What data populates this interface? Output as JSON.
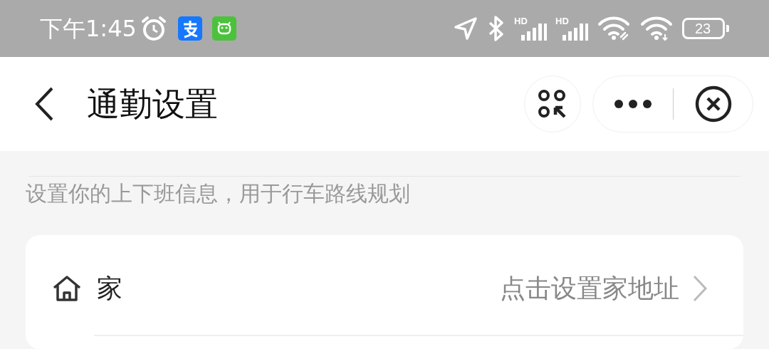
{
  "status_bar": {
    "time": "下午1:45",
    "signal_labels": [
      "HD",
      "HD"
    ],
    "battery": "23"
  },
  "header": {
    "title": "通勤设置"
  },
  "description": "设置你的上下班信息，用于行车路线规划",
  "settings": [
    {
      "label": "家",
      "value": "点击设置家地址"
    }
  ]
}
